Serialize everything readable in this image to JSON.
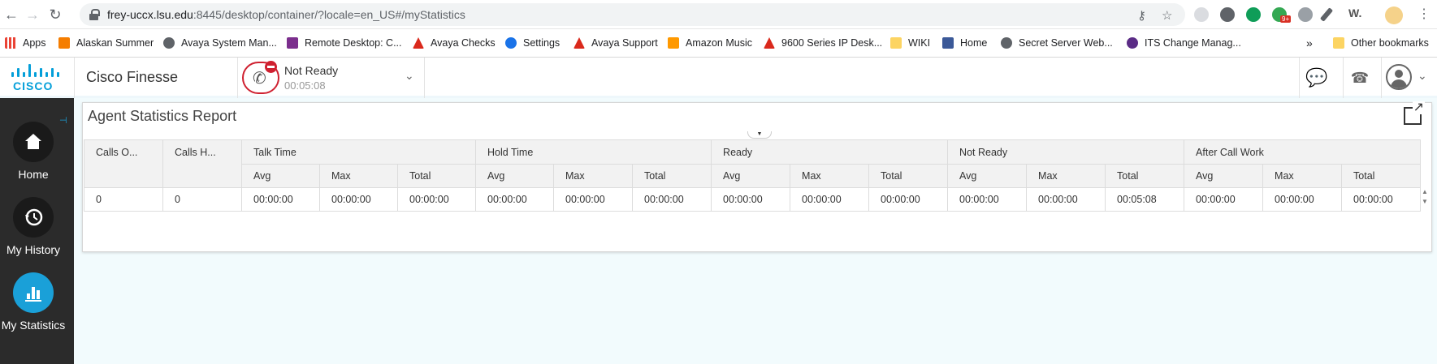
{
  "browser": {
    "url_host": "frey-uccx.lsu.edu",
    "url_rest": ":8445/desktop/container/?locale=en_US#/myStatistics",
    "bookmarks": [
      {
        "label": "Apps",
        "icon": "apps-grid-icon",
        "color": "#ea4335"
      },
      {
        "label": "Alaskan Summer",
        "icon": "blogger-icon",
        "color": "#f57d00"
      },
      {
        "label": "Avaya System Man...",
        "icon": "globe-icon",
        "color": "#5f6368"
      },
      {
        "label": "Remote Desktop: C...",
        "icon": "grok-icon",
        "color": "#7b2e8d"
      },
      {
        "label": "Avaya Checks",
        "icon": "avaya-icon",
        "color": "#da291c"
      },
      {
        "label": "Settings",
        "icon": "gear-icon",
        "color": "#1a73e8"
      },
      {
        "label": "Avaya Support",
        "icon": "avaya-icon",
        "color": "#da291c"
      },
      {
        "label": "Amazon Music",
        "icon": "amazon-icon",
        "color": "#ff9900"
      },
      {
        "label": "9600 Series IP Desk...",
        "icon": "avaya-icon",
        "color": "#da291c"
      },
      {
        "label": "WIKI",
        "icon": "folder-icon",
        "color": "#fcd462"
      },
      {
        "label": "Home",
        "icon": "facebook-icon",
        "color": "#3b5998"
      },
      {
        "label": "Secret Server Web...",
        "icon": "globe-icon",
        "color": "#5f6368"
      },
      {
        "label": "ITS Change Manag...",
        "icon": "paw-icon",
        "color": "#5b2c86"
      }
    ],
    "overflow": "»",
    "other_bookmarks": "Other bookmarks",
    "badge": "9+"
  },
  "header": {
    "app_name": "Cisco Finesse",
    "logo_text": "CISCO",
    "agent_state": "Not Ready",
    "state_timer": "00:05:08"
  },
  "sidebar": {
    "items": [
      {
        "label": "Home",
        "icon": "home-icon",
        "active": false
      },
      {
        "label": "My History",
        "icon": "history-icon",
        "active": false
      },
      {
        "label": "My Statistics",
        "icon": "bar-chart-icon",
        "active": true
      }
    ]
  },
  "report": {
    "title": "Agent Statistics Report",
    "groups": [
      "Talk Time",
      "Hold Time",
      "Ready",
      "Not Ready",
      "After Call Work"
    ],
    "single_columns": [
      "Calls O...",
      "Calls H..."
    ],
    "sub_columns": [
      "Avg",
      "Max",
      "Total"
    ],
    "row": [
      "0",
      "0",
      "00:00:00",
      "00:00:00",
      "00:00:00",
      "00:00:00",
      "00:00:00",
      "00:00:00",
      "00:00:00",
      "00:00:00",
      "00:00:00",
      "00:00:00",
      "00:00:00",
      "00:05:08",
      "00:00:00",
      "00:00:00",
      "00:00:00"
    ]
  },
  "colors": {
    "accent": "#049fd9",
    "not_ready": "#cf2030",
    "sidebar_bg": "#2b2b2b",
    "active_nav": "#1aa0d8"
  }
}
